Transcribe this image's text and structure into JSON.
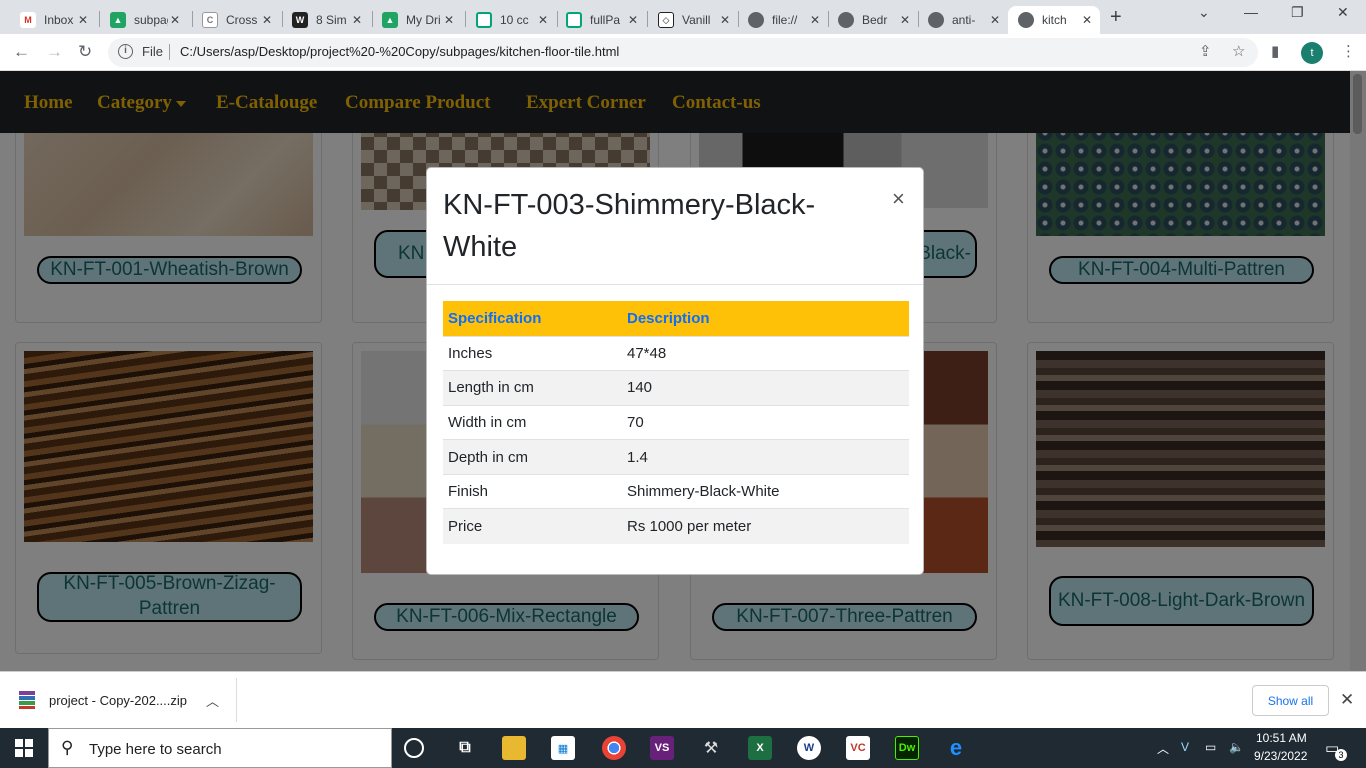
{
  "browser": {
    "tabs": [
      {
        "title": "Inbox",
        "icon": "gmail-icon",
        "color": "#d93025"
      },
      {
        "title": "subpages",
        "icon": "drive-icon",
        "color": "#1fa463"
      },
      {
        "title": "Cross",
        "icon": "css3-icon",
        "color": "#777777"
      },
      {
        "title": "8 Sim",
        "icon": "w-logo-icon",
        "color": "#222222"
      },
      {
        "title": "My Drive",
        "icon": "drive-icon",
        "color": "#1fa463"
      },
      {
        "title": "10 cc",
        "icon": "grid-icon",
        "color": "#00a676"
      },
      {
        "title": "fullPa",
        "icon": "grid-icon",
        "color": "#00a676"
      },
      {
        "title": "Vanill",
        "icon": "codepen-icon",
        "color": "#222222"
      },
      {
        "title": "file://",
        "icon": "globe-icon",
        "color": "#5f6368"
      },
      {
        "title": "Bedr",
        "icon": "globe-icon",
        "color": "#5f6368"
      },
      {
        "title": "anti-",
        "icon": "globe-icon",
        "color": "#5f6368"
      },
      {
        "title": "kitch",
        "icon": "globe-icon",
        "color": "#5f6368",
        "active": true
      }
    ],
    "omnibox": {
      "scheme_label": "File",
      "url": "C:/Users/asp/Desktop/project%20-%20Copy/subpages/kitchen-floor-tile.html"
    },
    "profile_initial": "t"
  },
  "navbar": {
    "items": [
      "Home",
      "Category",
      "E-Catalouge",
      "Compare Product",
      "Expert Corner",
      "Contact-us"
    ]
  },
  "products": [
    {
      "name": "KN-FT-001-Wheatish-Brown"
    },
    {
      "name": "KN"
    },
    {
      "name": "Black-"
    },
    {
      "name": "KN-FT-004-Multi-Pattren"
    },
    {
      "name": "KN-FT-005-Brown-Zizag-Pattren"
    },
    {
      "name": "KN-FT-006-Mix-Rectangle"
    },
    {
      "name": "KN-FT-007-Three-Pattren"
    },
    {
      "name": "KN-FT-008-Light-Dark-Brown"
    }
  ],
  "modal": {
    "title": "KN-FT-003-Shimmery-Black-White",
    "close_label": "×",
    "table": {
      "headers": [
        "Specification",
        "Description"
      ],
      "rows": [
        [
          "Inches",
          "47*48"
        ],
        [
          "Length in cm",
          "140"
        ],
        [
          "Width in cm",
          "70"
        ],
        [
          "Depth in cm",
          "1.4"
        ],
        [
          "Finish",
          "Shimmery-Black-White"
        ],
        [
          "Price",
          "Rs 1000 per meter"
        ]
      ]
    }
  },
  "downloads": {
    "file_name": "project - Copy-202....zip",
    "show_all": "Show all"
  },
  "taskbar": {
    "search_placeholder": "Type here to search",
    "time": "10:51 AM",
    "date": "9/23/2022",
    "notification_count": "3"
  },
  "colors": {
    "accent": "#ffc107",
    "navbar_bg": "#212529",
    "caption_bg": "#bfe8f2",
    "table_header_text": "#0d6efd"
  }
}
